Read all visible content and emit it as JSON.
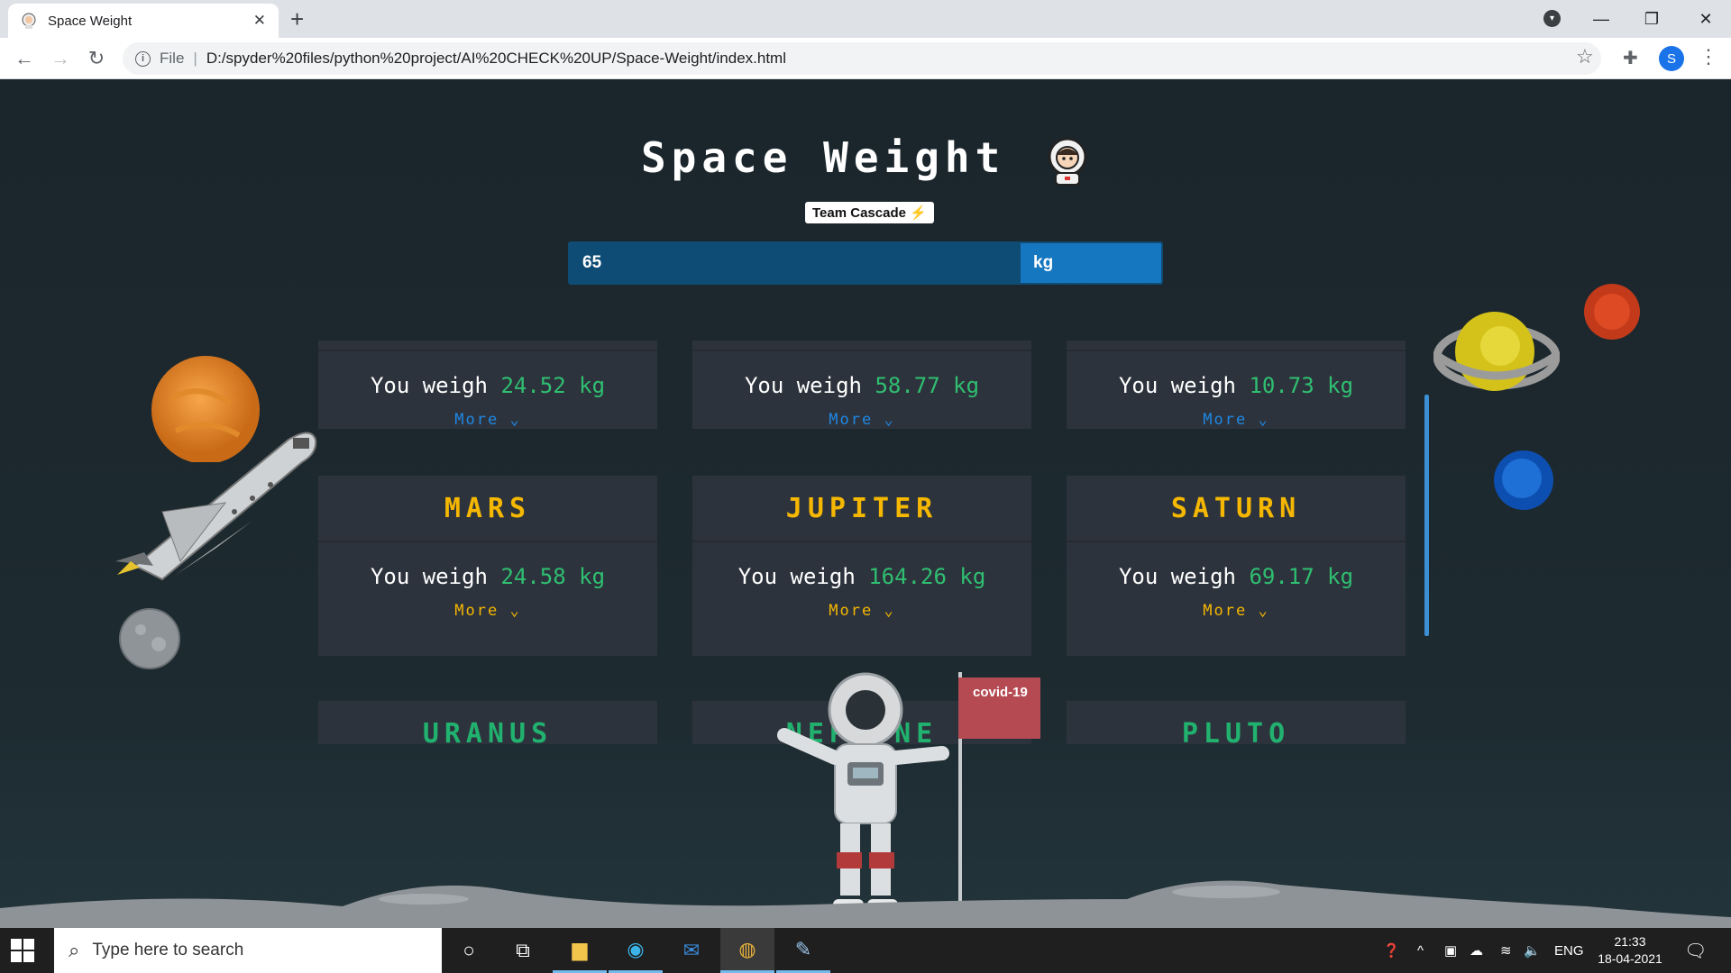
{
  "browser": {
    "tab_title": "Space Weight",
    "url_scheme": "File",
    "url": "D:/spyder%20files/python%20project/AI%20CHECK%20UP/Space-Weight/index.html",
    "profile_initial": "S"
  },
  "app": {
    "title": "Space Weight",
    "team_badge": "Team Cascade",
    "weight_value": "65",
    "unit": "kg"
  },
  "cards": [
    {
      "name": "",
      "weight": "24.52",
      "unit": "kg",
      "more": "More",
      "name_color": "#1e88e5",
      "more_color": "#1e88e5"
    },
    {
      "name": "",
      "weight": "58.77",
      "unit": "kg",
      "more": "More",
      "name_color": "#1e88e5",
      "more_color": "#1e88e5"
    },
    {
      "name": "",
      "weight": "10.73",
      "unit": "kg",
      "more": "More",
      "name_color": "#1e88e5",
      "more_color": "#1e88e5"
    },
    {
      "name": "MARS",
      "weight": "24.58",
      "unit": "kg",
      "more": "More",
      "name_color": "#f5b700",
      "more_color": "#f5b700"
    },
    {
      "name": "JUPITER",
      "weight": "164.26",
      "unit": "kg",
      "more": "More",
      "name_color": "#f5b700",
      "more_color": "#f5b700"
    },
    {
      "name": "SATURN",
      "weight": "69.17",
      "unit": "kg",
      "more": "More",
      "name_color": "#f5b700",
      "more_color": "#f5b700"
    },
    {
      "name": "URANUS",
      "weight": "",
      "unit": "",
      "more": "",
      "name_color": "#21b26f",
      "more_color": "#21b26f"
    },
    {
      "name": "NEPTUNE",
      "weight": "",
      "unit": "",
      "more": "",
      "name_color": "#21b26f",
      "more_color": "#21b26f"
    },
    {
      "name": "PLUTO",
      "weight": "",
      "unit": "",
      "more": "",
      "name_color": "#21b26f",
      "more_color": "#21b26f"
    }
  ],
  "weigh_prefix": "You weigh",
  "flag_label": "covid-19",
  "taskbar": {
    "search_placeholder": "Type here to search",
    "language": "ENG",
    "time": "21:33",
    "date": "18-04-2021"
  }
}
